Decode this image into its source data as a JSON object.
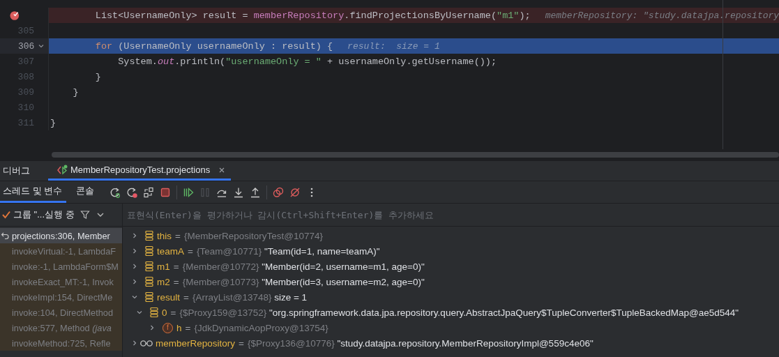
{
  "editor": {
    "lines": [
      {
        "breakpoint": true,
        "current": false,
        "fold_marker": false,
        "tokens": [
          {
            "text": "        List<UsernameOnly> result = ",
            "kind": "plain"
          },
          {
            "text": "memberRepository",
            "kind": "field"
          },
          {
            "text": ".findProjectionsByUsername(",
            "kind": "plain"
          },
          {
            "text": "\"m1\"",
            "kind": "string"
          },
          {
            "text": ");",
            "kind": "plain"
          },
          {
            "text": "memberRepository: \"study.datajpa.repository",
            "kind": "hint"
          }
        ]
      },
      {
        "number": "305",
        "breakpoint": false,
        "current": false,
        "fold_marker": false
      },
      {
        "number": "306",
        "breakpoint": false,
        "current": true,
        "fold_marker": true,
        "tokens": [
          {
            "text": "        for",
            "kind": "keyword"
          },
          {
            "text": " (UsernameOnly usernameOnly : result) {",
            "kind": "plain"
          },
          {
            "text": "result:  size = 1",
            "kind": "hint"
          }
        ]
      },
      {
        "number": "307",
        "breakpoint": false,
        "current": false,
        "fold_marker": false,
        "tokens": [
          {
            "text": "            System.",
            "kind": "plain"
          },
          {
            "text": "out",
            "kind": "static"
          },
          {
            "text": ".println(",
            "kind": "plain"
          },
          {
            "text": "\"usernameOnly = \"",
            "kind": "string"
          },
          {
            "text": " + usernameOnly.getUsername());",
            "kind": "plain"
          }
        ]
      },
      {
        "number": "308",
        "breakpoint": false,
        "current": false,
        "fold_marker": false,
        "tokens": [
          {
            "text": "        }",
            "kind": "plain"
          }
        ]
      },
      {
        "number": "309",
        "breakpoint": false,
        "current": false,
        "fold_marker": false,
        "tokens": [
          {
            "text": "    }",
            "kind": "plain"
          }
        ]
      },
      {
        "number": "310",
        "breakpoint": false,
        "current": false,
        "fold_marker": false
      },
      {
        "number": "311",
        "breakpoint": false,
        "current": false,
        "fold_marker": false,
        "tokens": [
          {
            "text": "}",
            "kind": "plain"
          }
        ]
      }
    ]
  },
  "debug_panel": {
    "title": "디버그",
    "session_tabs": [
      {
        "label": "MemberRepositoryTest.projections",
        "selected": true
      }
    ],
    "view_tabs": [
      {
        "label": "스레드 및 변수",
        "selected": true
      },
      {
        "label": "콘솔",
        "selected": false
      }
    ],
    "toolbar": [
      {
        "kind": "rerun",
        "disabled": false
      },
      {
        "kind": "rerun-failed",
        "disabled": false
      },
      {
        "kind": "restore",
        "disabled": false
      },
      {
        "kind": "stop",
        "disabled": false
      },
      {
        "kind": "separator"
      },
      {
        "kind": "resume",
        "disabled": false
      },
      {
        "kind": "pause",
        "disabled": true
      },
      {
        "kind": "step-over",
        "disabled": false
      },
      {
        "kind": "step-into",
        "disabled": false
      },
      {
        "kind": "step-out",
        "disabled": false
      },
      {
        "kind": "separator"
      },
      {
        "kind": "breakpoints",
        "disabled": false
      },
      {
        "kind": "mute",
        "disabled": false
      },
      {
        "kind": "more",
        "disabled": false
      }
    ],
    "thread_selector": "그룹 \"...실행 중",
    "frames": [
      {
        "text": "projections:306, Member",
        "selected": true,
        "library": false
      },
      {
        "text": "invokeVirtual:-1, LambdaF",
        "selected": false,
        "library": true
      },
      {
        "text": "invoke:-1, LambdaForm$M",
        "selected": false,
        "library": true
      },
      {
        "text": "invokeExact_MT:-1, Invok",
        "selected": false,
        "library": true
      },
      {
        "text": "invokeImpl:154, DirectMe",
        "selected": false,
        "library": true
      },
      {
        "text": "invoke:104, DirectMethod",
        "selected": false,
        "library": true
      },
      {
        "text": "invoke:577, Method *(java*",
        "selected": false,
        "library": true
      },
      {
        "text": "invokeMethod:725, Refle",
        "selected": false,
        "library": true
      }
    ],
    "expression": {
      "placeholder": "표현식(Enter)을 평가하거나 감시(Ctrl+Shift+Enter)를 추가하세요"
    },
    "variables": [
      {
        "kind": "field",
        "name": "this",
        "op": "=",
        "type": "{MemberRepositoryTest@10774}",
        "expanded": false
      },
      {
        "kind": "field",
        "name": "teamA",
        "op": "=",
        "type": "{Team@10771}",
        "value": "\"Team(id=1, name=teamA)\"",
        "expanded": false
      },
      {
        "kind": "field",
        "name": "m1",
        "op": "=",
        "type": "{Member@10772}",
        "value": "\"Member(id=2, username=m1, age=0)\"",
        "expanded": false
      },
      {
        "kind": "field",
        "name": "m2",
        "op": "=",
        "type": "{Member@10773}",
        "value": "\"Member(id=3, username=m2, age=0)\"",
        "expanded": false
      },
      {
        "kind": "field",
        "name": "result",
        "op": "=",
        "type": "{ArrayList@13748}",
        "value": "size = 1",
        "expanded": true,
        "children": [
          {
            "kind": "field",
            "name": "0",
            "op": "=",
            "type": "{$Proxy159@13752}",
            "value": "\"org.springframework.data.jpa.repository.query.AbstractJpaQuery$TupleConverter$TupleBackedMap@ae5d544\"",
            "expanded": true,
            "children": [
              {
                "kind": "letter",
                "icon_text": "f",
                "name": "h",
                "op": "=",
                "type": "{JdkDynamicAopProxy@13754}",
                "expanded": false
              }
            ]
          }
        ]
      },
      {
        "kind": "watch",
        "name": "memberRepository",
        "op": "=",
        "type": "{$Proxy136@10776}",
        "value": "\"study.datajpa.repository.MemberRepositoryImpl@559c4e06\"",
        "expanded": false
      }
    ]
  }
}
